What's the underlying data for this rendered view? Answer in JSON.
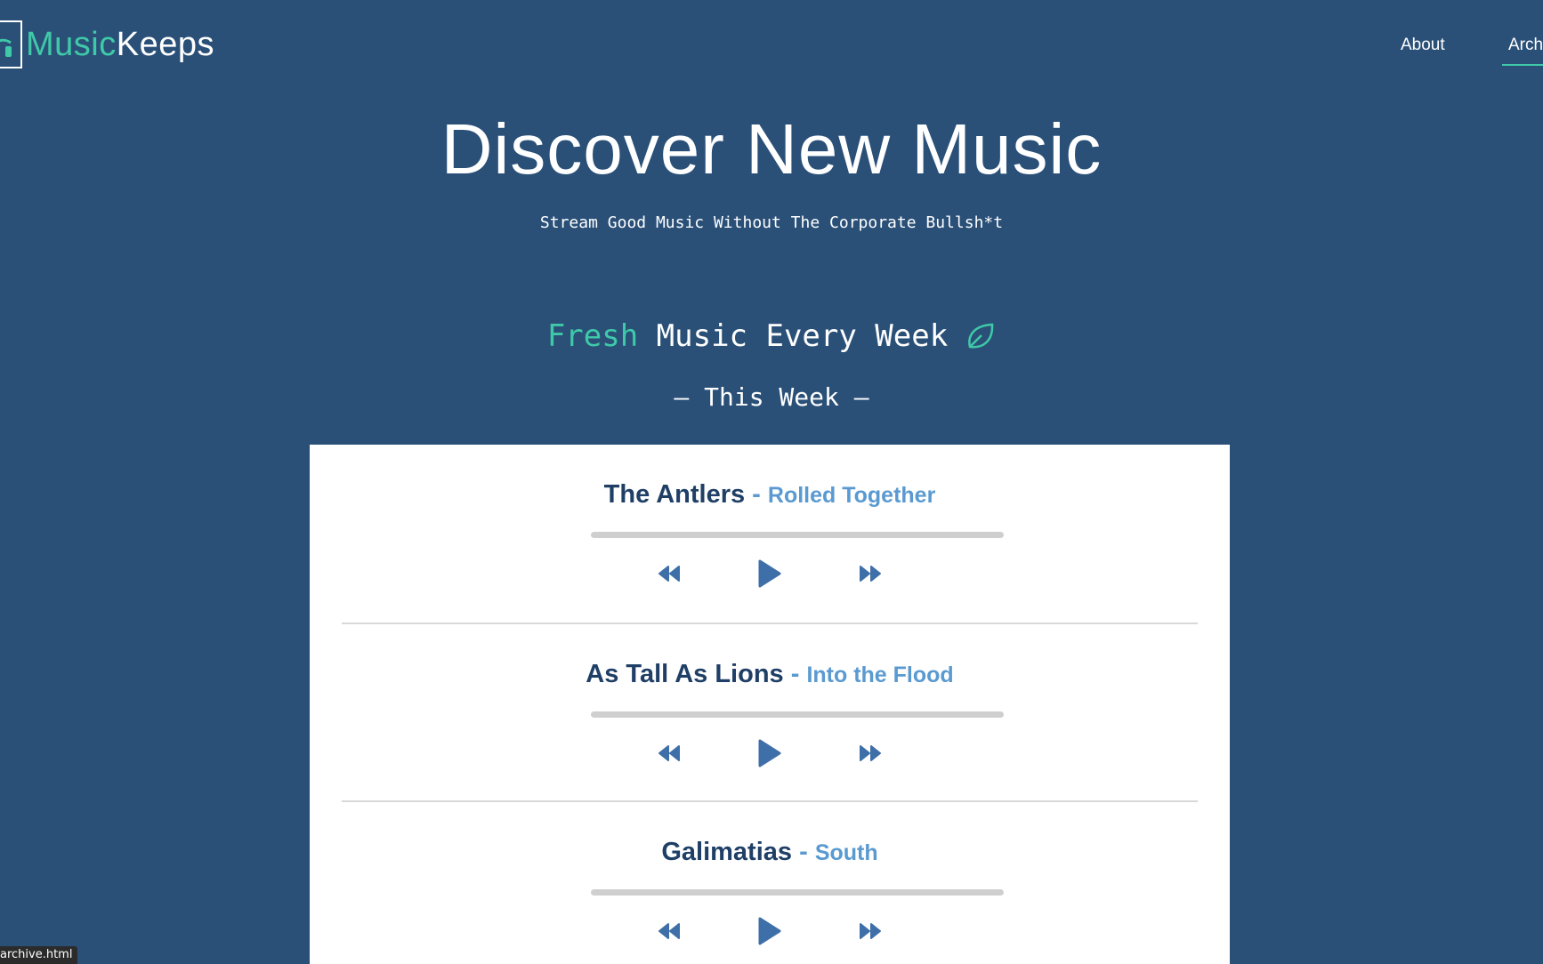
{
  "brand": {
    "part1": "Music",
    "part2": "Keeps",
    "icon": "headphones-icon",
    "accent_color": "#3fc9a8"
  },
  "nav": {
    "about": "About",
    "archive": "Arch"
  },
  "hero": {
    "title": "Discover New Music",
    "subtitle": "Stream Good Music Without The Corporate Bullsh*t"
  },
  "section": {
    "fresh_accent": "Fresh",
    "fresh_rest": "Music Every Week",
    "leaf_icon": "leaf-icon",
    "this_week": "— This Week —"
  },
  "tracks": [
    {
      "artist": "The Antlers",
      "sep": " - ",
      "song": "Rolled Together",
      "progress": 0
    },
    {
      "artist": "As Tall As Lions",
      "sep": " - ",
      "song": "Into the Flood",
      "progress": 0
    },
    {
      "artist": "Galimatias",
      "sep": " - ",
      "song": "South",
      "progress": 0
    }
  ],
  "controls": {
    "rewind_icon": "rewind-icon",
    "play_icon": "play-icon",
    "fast_forward_icon": "fast-forward-icon"
  },
  "status_bar": {
    "url": "archive.html"
  },
  "colors": {
    "background": "#2a5078",
    "card": "#ffffff",
    "artist": "#1f3f66",
    "song": "#5a9ad0",
    "control": "#3f6fa8"
  }
}
